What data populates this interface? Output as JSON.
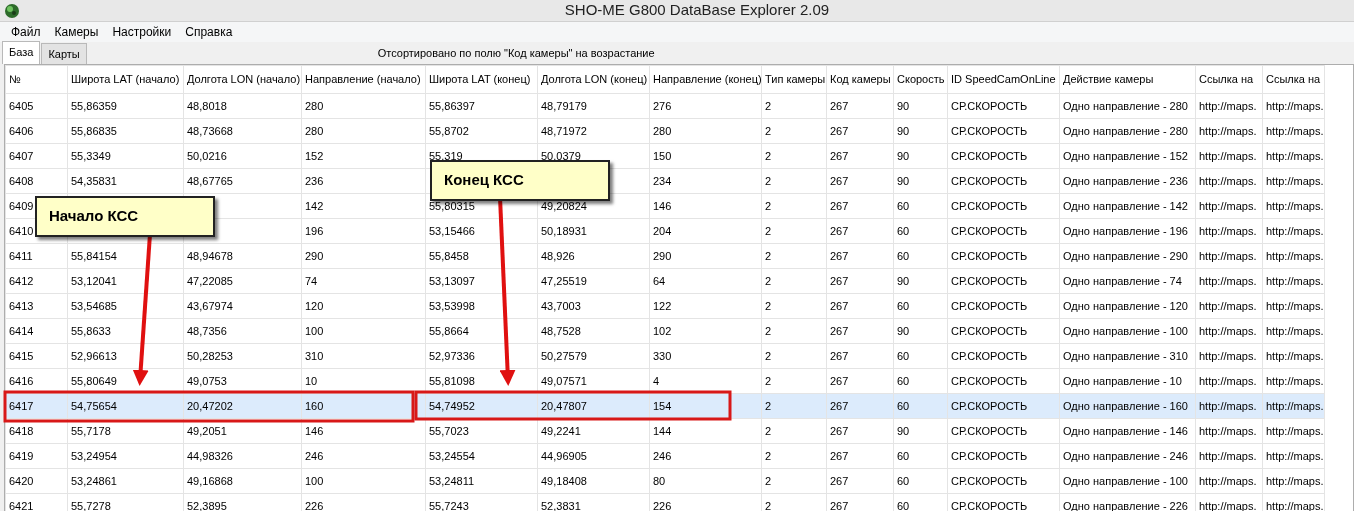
{
  "window": {
    "title": "SHO-ME G800 DataBase Explorer 2.09"
  },
  "menu": [
    "Файл",
    "Камеры",
    "Настройки",
    "Справка"
  ],
  "tabs": [
    {
      "label": "База",
      "selected": true
    },
    {
      "label": "Карты",
      "selected": false
    }
  ],
  "sort_status": "Отсортировано по полю \"Код камеры\" на возрастание",
  "table": {
    "columns": [
      "№",
      "Широта LAT (начало)",
      "Долгота LON (начало)",
      "Направление (начало)",
      "Широта LAT (конец)",
      "Долгота LON (конец)",
      "Направление (конец)",
      "Тип камеры",
      "Код камеры",
      "Скорость",
      "ID SpeedCamOnLine",
      "Действие камеры",
      "Ссылка на",
      "Ссылка на"
    ],
    "rows": [
      {
        "selected": false,
        "cells": [
          "6405",
          "55,86359",
          "48,8018",
          "280",
          "55,86397",
          "48,79179",
          "276",
          "2",
          "267",
          "90",
          "СР.СКОРОСТЬ",
          "Одно направление - 280",
          "http://maps.",
          "http://maps."
        ]
      },
      {
        "selected": false,
        "cells": [
          "6406",
          "55,86835",
          "48,73668",
          "280",
          "55,8702",
          "48,71972",
          "280",
          "2",
          "267",
          "90",
          "СР.СКОРОСТЬ",
          "Одно направление - 280",
          "http://maps.",
          "http://maps."
        ]
      },
      {
        "selected": false,
        "cells": [
          "6407",
          "55,3349",
          "50,0216",
          "152",
          "55,319",
          "50,0379",
          "150",
          "2",
          "267",
          "90",
          "СР.СКОРОСТЬ",
          "Одно направление - 152",
          "http://maps.",
          "http://maps."
        ]
      },
      {
        "selected": false,
        "cells": [
          "6408",
          "54,35831",
          "48,67765",
          "236",
          null,
          null,
          "234",
          "2",
          "267",
          "90",
          "СР.СКОРОСТЬ",
          "Одно направление - 236",
          "http://maps.",
          "http://maps."
        ]
      },
      {
        "selected": false,
        "cells": [
          "6409",
          null,
          null,
          "142",
          "55,80315",
          "49,20824",
          "146",
          "2",
          "267",
          "60",
          "СР.СКОРОСТЬ",
          "Одно направление - 142",
          "http://maps.",
          "http://maps."
        ]
      },
      {
        "selected": false,
        "cells": [
          "6410",
          null,
          null,
          "196",
          "53,15466",
          "50,18931",
          "204",
          "2",
          "267",
          "60",
          "СР.СКОРОСТЬ",
          "Одно направление - 196",
          "http://maps.",
          "http://maps."
        ]
      },
      {
        "selected": false,
        "cells": [
          "6411",
          "55,84154",
          "48,94678",
          "290",
          "55,8458",
          "48,926",
          "290",
          "2",
          "267",
          "60",
          "СР.СКОРОСТЬ",
          "Одно направление - 290",
          "http://maps.",
          "http://maps."
        ]
      },
      {
        "selected": false,
        "cells": [
          "6412",
          "53,12041",
          "47,22085",
          "74",
          "53,13097",
          "47,25519",
          "64",
          "2",
          "267",
          "90",
          "СР.СКОРОСТЬ",
          "Одно направление - 74",
          "http://maps.",
          "http://maps."
        ]
      },
      {
        "selected": false,
        "cells": [
          "6413",
          "53,54685",
          "43,67974",
          "120",
          "53,53998",
          "43,7003",
          "122",
          "2",
          "267",
          "60",
          "СР.СКОРОСТЬ",
          "Одно направление - 120",
          "http://maps.",
          "http://maps."
        ]
      },
      {
        "selected": false,
        "cells": [
          "6414",
          "55,8633",
          "48,7356",
          "100",
          "55,8664",
          "48,7528",
          "102",
          "2",
          "267",
          "90",
          "СР.СКОРОСТЬ",
          "Одно направление - 100",
          "http://maps.",
          "http://maps."
        ]
      },
      {
        "selected": false,
        "cells": [
          "6415",
          "52,96613",
          "50,28253",
          "310",
          "52,97336",
          "50,27579",
          "330",
          "2",
          "267",
          "60",
          "СР.СКОРОСТЬ",
          "Одно направление - 310",
          "http://maps.",
          "http://maps."
        ]
      },
      {
        "selected": false,
        "cells": [
          "6416",
          "55,80649",
          "49,0753",
          "10",
          "55,81098",
          "49,07571",
          "4",
          "2",
          "267",
          "60",
          "СР.СКОРОСТЬ",
          "Одно направление - 10",
          "http://maps.",
          "http://maps."
        ]
      },
      {
        "selected": true,
        "cells": [
          "6417",
          "54,75654",
          "20,47202",
          "160",
          "54,74952",
          "20,47807",
          "154",
          "2",
          "267",
          "60",
          "СР.СКОРОСТЬ",
          "Одно направление - 160",
          "http://maps.",
          "http://maps."
        ]
      },
      {
        "selected": false,
        "cells": [
          "6418",
          "55,7178",
          "49,2051",
          "146",
          "55,7023",
          "49,2241",
          "144",
          "2",
          "267",
          "90",
          "СР.СКОРОСТЬ",
          "Одно направление - 146",
          "http://maps.",
          "http://maps."
        ]
      },
      {
        "selected": false,
        "cells": [
          "6419",
          "53,24954",
          "44,98326",
          "246",
          "53,24554",
          "44,96905",
          "246",
          "2",
          "267",
          "60",
          "СР.СКОРОСТЬ",
          "Одно направление - 246",
          "http://maps.",
          "http://maps."
        ]
      },
      {
        "selected": false,
        "cells": [
          "6420",
          "53,24861",
          "49,16868",
          "100",
          "53,24811",
          "49,18408",
          "80",
          "2",
          "267",
          "60",
          "СР.СКОРОСТЬ",
          "Одно направление - 100",
          "http://maps.",
          "http://maps."
        ]
      },
      {
        "selected": false,
        "cells": [
          "6421",
          "55,7278",
          "52,3895",
          "226",
          "55,7243",
          "52,3831",
          "226",
          "2",
          "267",
          "60",
          "СР.СКОРОСТЬ",
          "Одно направление - 226",
          "http://maps.",
          "http://maps."
        ]
      }
    ]
  },
  "annotations": [
    {
      "text": "Начало КСС"
    },
    {
      "text": "Конец КСС"
    }
  ]
}
